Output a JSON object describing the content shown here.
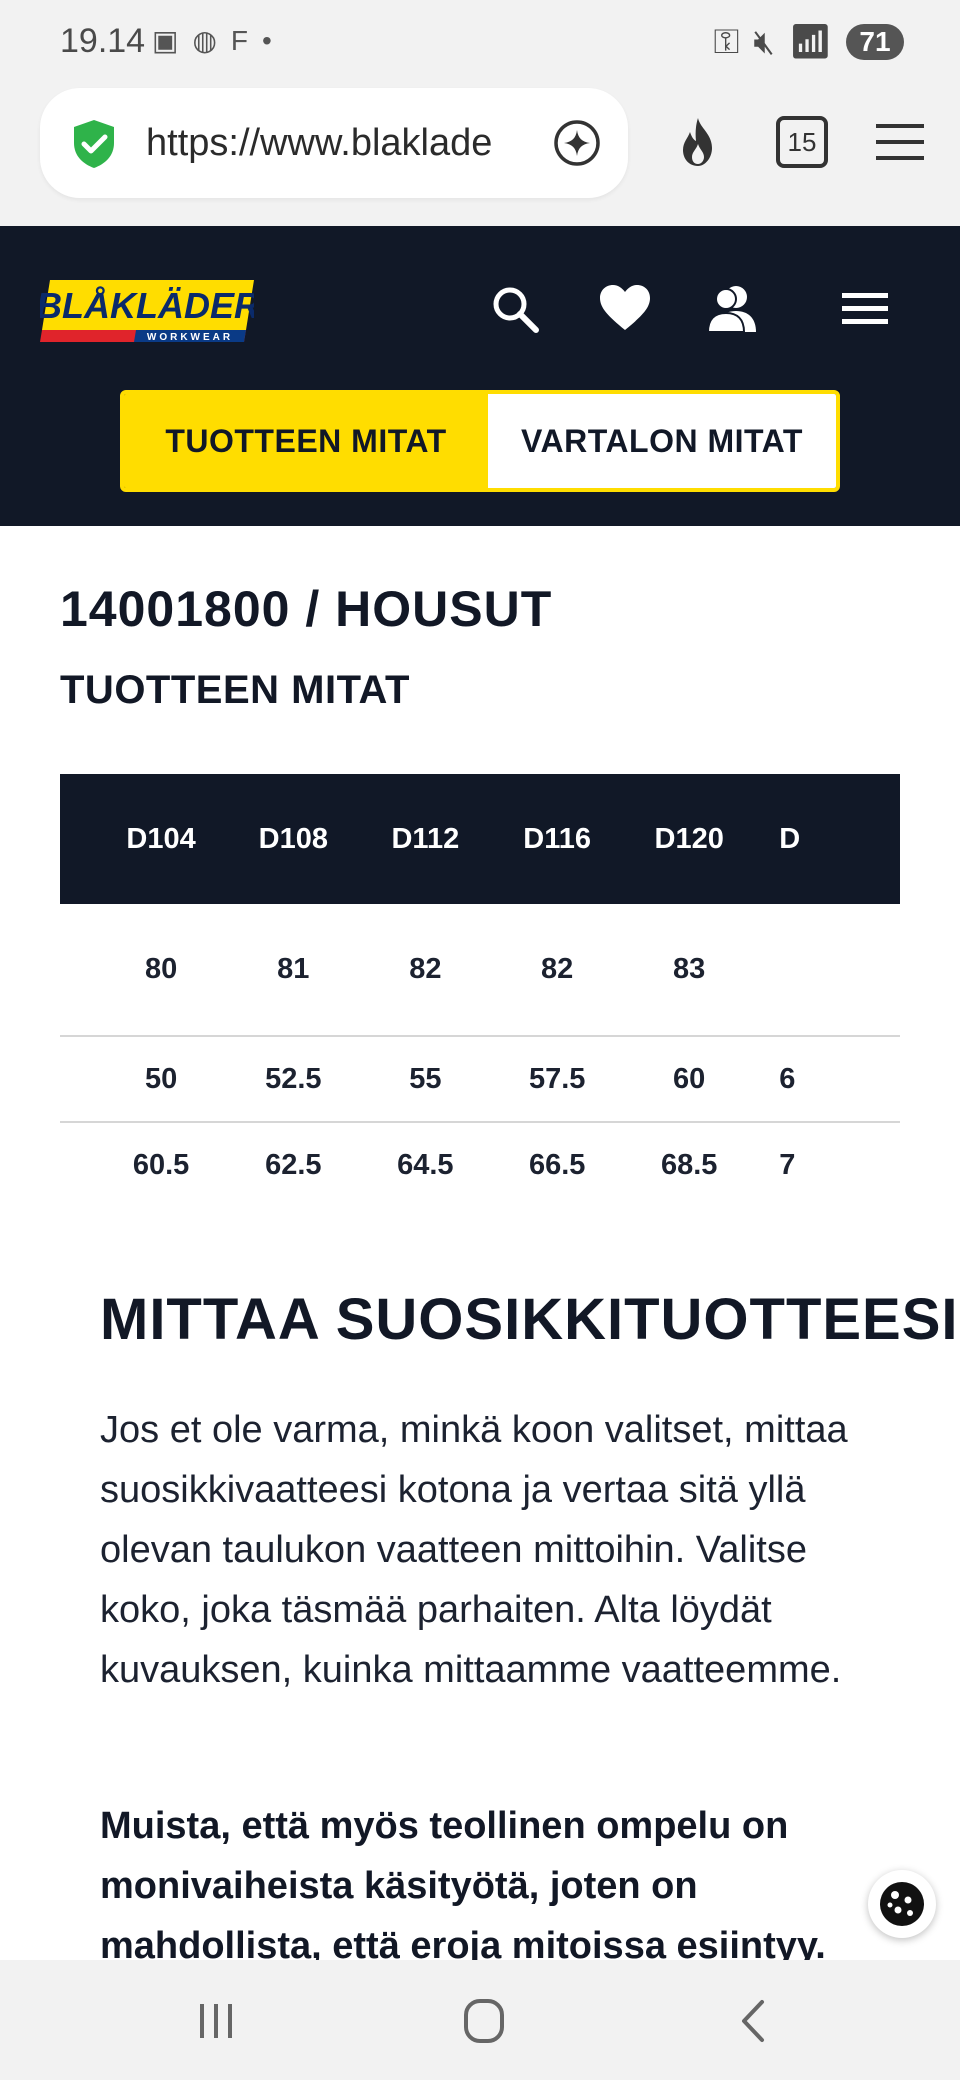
{
  "status_bar": {
    "time": "19.14",
    "notif_text": "F",
    "battery": "71"
  },
  "browser": {
    "url": "https://www.blaklade",
    "tabs_count": "15"
  },
  "site": {
    "logo_text": "BLÅKLÄDER",
    "logo_sub": "WORKWEAR",
    "toggle": {
      "product_label": "TUOTTEEN MITAT",
      "body_label": "VARTALON MITAT"
    }
  },
  "content": {
    "product_title": "14001800 / HOUSUT",
    "subtitle": "TUOTTEEN MITAT",
    "table": {
      "headers": [
        "D104",
        "D108",
        "D112",
        "D116",
        "D120",
        "D"
      ],
      "rows": [
        [
          "80",
          "81",
          "82",
          "82",
          "83",
          ""
        ],
        [
          "50",
          "52.5",
          "55",
          "57.5",
          "60",
          "6"
        ],
        [
          "60.5",
          "62.5",
          "64.5",
          "66.5",
          "68.5",
          "7"
        ]
      ]
    },
    "measure_heading": "MITTAA SUOSIKKITUOTTEESI",
    "paragraph": "Jos et ole varma, minkä koon valitset, mittaa suosikkivaatteesi kotona ja vertaa sitä yllä olevan taulukon vaatteen mittoihin. Valitse koko, joka täsmää parhaiten. Alta löydät kuvauksen, kuinka mittaamme vaatteemme.",
    "paragraph_bold": "Muista, että myös teollinen ompelu on monivaiheista käsityötä, joten on mahdollista, että eroja mitoissa esiintyy."
  },
  "colors": {
    "header_bg": "#111827",
    "accent_yellow": "#ffdd00",
    "logo_red": "#e0242b",
    "logo_blue": "#0a3a86"
  }
}
